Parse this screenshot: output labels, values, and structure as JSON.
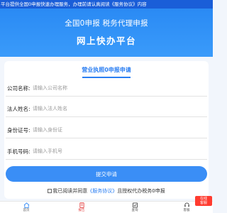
{
  "notice": {
    "text": "平台提供全国0申报快速办理服务，办理前请认真阅读《服务协议》内容"
  },
  "hero": {
    "line1": "全国0申报  税务代理申报",
    "line2": "网上快办平台"
  },
  "form": {
    "title": "营业执照0申报申请",
    "fields": [
      {
        "label": "公司名称:",
        "placeholder": "请输入公司名称"
      },
      {
        "label": "法人姓名:",
        "placeholder": "请输入法人姓名"
      },
      {
        "label": "身份证号:",
        "placeholder": "请输入身份证"
      },
      {
        "label": "手机号码:",
        "placeholder": "请输入手机号"
      }
    ],
    "submit_label": "提交申请",
    "agree": {
      "prefix": "我已阅读并同意",
      "link": "《服务协议》",
      "suffix": "且授权代办税务0申报"
    }
  },
  "tabbar": {
    "items": [
      {
        "label": "首页",
        "icon": "home-icon",
        "active": false
      },
      {
        "label": "报告",
        "icon": "report-icon",
        "active": true
      },
      {
        "label": "查询",
        "icon": "query-icon",
        "active": false
      },
      {
        "label": "客服",
        "icon": "customer-service-icon",
        "active": false
      }
    ]
  },
  "float_badge": {
    "line1": "在线",
    "line2": "客服"
  },
  "colors": {
    "primary": "#2a7ef2",
    "banner_dark": "#1a5ed8",
    "hero": "#3a9bfa",
    "active_tab": "#e23b3b",
    "badge": "#ff3b2f"
  }
}
